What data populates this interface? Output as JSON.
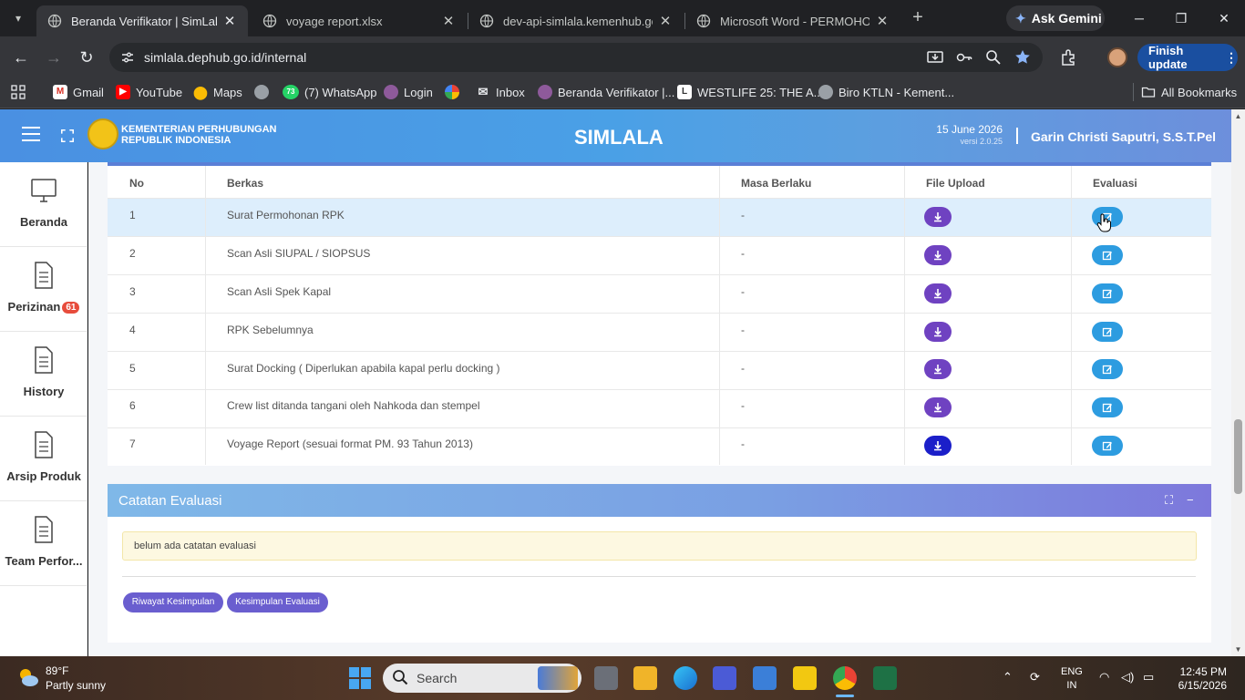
{
  "browser": {
    "tabs": [
      {
        "title": "Beranda Verifikator | SimLala",
        "active": true
      },
      {
        "title": "voyage report.xlsx",
        "active": false
      },
      {
        "title": "dev-api-simlala.kemenhub.go.id",
        "active": false
      },
      {
        "title": "Microsoft Word - PERMOHONA",
        "active": false
      }
    ],
    "ask_gemini": "Ask Gemini",
    "url": "simlala.dephub.go.id/internal",
    "finish_update": "Finish update",
    "bookmarks": [
      {
        "label": "Gmail",
        "icon": "gmail-icon"
      },
      {
        "label": "YouTube",
        "icon": "youtube-icon"
      },
      {
        "label": "Maps",
        "icon": "maps-icon"
      },
      {
        "label": "",
        "icon": "globe-icon"
      },
      {
        "label": "(7) WhatsApp",
        "icon": "whatsapp-icon",
        "badge": "73"
      },
      {
        "label": "Login",
        "icon": "globe-icon"
      },
      {
        "label": "",
        "icon": "pinwheel-icon"
      },
      {
        "label": "Inbox",
        "icon": "mail-icon"
      },
      {
        "label": "Beranda Verifikator |...",
        "icon": "globe-icon"
      },
      {
        "label": "WESTLIFE 25: THE A...",
        "icon": "page-icon"
      },
      {
        "label": "Biro KTLN - Kement...",
        "icon": "globe-icon"
      }
    ],
    "all_bookmarks": "All Bookmarks"
  },
  "header": {
    "ministry_line1": "KEMENTERIAN PERHUBUNGAN",
    "ministry_line2": "REPUBLIK INDONESIA",
    "app_name": "SIMLALA",
    "date": "15 June 2026",
    "version": "versi 2.0.25",
    "user": "Garin Christi Saputri, S.S.T.Pel"
  },
  "sidebar": {
    "items": [
      {
        "label": "Beranda",
        "icon": "monitor-icon"
      },
      {
        "label": "Perizinan",
        "icon": "document-icon",
        "badge": "61"
      },
      {
        "label": "History",
        "icon": "document-icon"
      },
      {
        "label": "Arsip Produk",
        "icon": "document-icon"
      },
      {
        "label": "Team Perfor...",
        "icon": "document-icon"
      }
    ]
  },
  "table": {
    "headers": {
      "no": "No",
      "berkas": "Berkas",
      "masa": "Masa Berlaku",
      "file": "File Upload",
      "evaluasi": "Evaluasi"
    },
    "rows": [
      {
        "no": "1",
        "berkas": "Surat Permohonan RPK",
        "masa": "-"
      },
      {
        "no": "2",
        "berkas": "Scan Asli SIUPAL / SIOPSUS",
        "masa": "-"
      },
      {
        "no": "3",
        "berkas": "Scan Asli Spek Kapal",
        "masa": "-"
      },
      {
        "no": "4",
        "berkas": "RPK Sebelumnya",
        "masa": "-"
      },
      {
        "no": "5",
        "berkas": "Surat Docking ( Diperlukan apabila kapal perlu docking )",
        "masa": "-"
      },
      {
        "no": "6",
        "berkas": "Crew list ditanda tangani oleh Nahkoda dan stempel",
        "masa": "-"
      },
      {
        "no": "7",
        "berkas": "Voyage Report (sesuai format PM. 93 Tahun 2013)",
        "masa": "-"
      }
    ]
  },
  "evaluation": {
    "title": "Catatan Evaluasi",
    "note": "belum ada catatan evaluasi",
    "btn_riwayat": "Riwayat Kesimpulan",
    "btn_kesimpulan": "Kesimpulan Evaluasi"
  },
  "taskbar": {
    "temp": "89°F",
    "condition": "Partly sunny",
    "search": "Search",
    "lang1": "ENG",
    "lang2": "IN",
    "time": "12:45 PM",
    "date": "6/15/2026"
  },
  "colors": {
    "header_blue": "#4a90e2",
    "purple_btn": "#6f42c1",
    "eval_btn": "#2d9ce0",
    "highlight_row": "#ddeefc"
  }
}
